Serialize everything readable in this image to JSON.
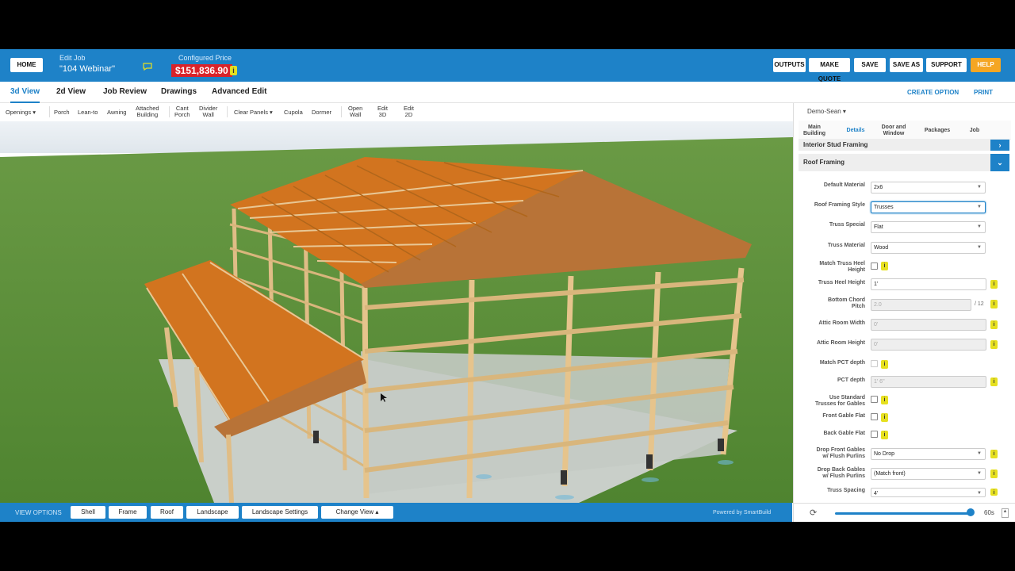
{
  "header": {
    "home_label": "HOME",
    "job_label": "Edit Job",
    "job_name": "\"104 Webinar\"",
    "price_label": "Configured Price",
    "price_value": "$151,836.90",
    "price_info": "i",
    "buttons": {
      "outputs": "OUTPUTS",
      "make_quote": "MAKE QUOTE",
      "save": "SAVE",
      "save_as": "SAVE AS",
      "support": "SUPPORT",
      "help": "HELP"
    }
  },
  "tabs": [
    "3d View",
    "2d View",
    "Job Review",
    "Drawings",
    "Advanced Edit"
  ],
  "tab_actions": {
    "create_option": "CREATE OPTION",
    "print": "PRINT"
  },
  "toolbar": {
    "openings": "Openings",
    "porch": "Porch",
    "lean_to": "Lean-to",
    "awning": "Awning",
    "attached_building": "Attached\nBuilding",
    "cant_porch": "Cant\nPorch",
    "divider_wall": "Divider\nWall",
    "clear_panels": "Clear Panels",
    "cupola": "Cupola",
    "dormer": "Dormer",
    "open_wall": "Open\nWall",
    "edit_3d": "Edit\n3D",
    "edit_2d": "Edit\n2D"
  },
  "bottom_bar": {
    "view_options": "VIEW OPTIONS",
    "shell": "Shell",
    "frame": "Frame",
    "roof": "Roof",
    "landscape": "Landscape",
    "landscape_settings": "Landscape Settings",
    "change_view": "Change View",
    "powered_by": "Powered by SmartBuild"
  },
  "panel": {
    "user": "Demo-Sean",
    "tabs": {
      "main_building": "Main\nBuilding",
      "details": "Details",
      "door_window": "Door and\nWindow",
      "packages": "Packages",
      "job": "Job"
    },
    "sections": {
      "interior_stud": "Interior Stud Framing",
      "roof_framing": "Roof Framing"
    },
    "fields": {
      "default_material": {
        "label": "Default Material",
        "value": "2x6"
      },
      "roof_framing_style": {
        "label": "Roof Framing Style",
        "value": "Trusses"
      },
      "truss_special": {
        "label": "Truss Special",
        "value": "Flat"
      },
      "truss_material": {
        "label": "Truss Material",
        "value": "Wood"
      },
      "match_truss_heel": {
        "label": "Match Truss Heel\nHeight"
      },
      "truss_heel_height": {
        "label": "Truss Heel Height",
        "value": "1'"
      },
      "bottom_chord_pitch": {
        "label": "Bottom Chord\nPitch",
        "value": "2.0",
        "suffix": "/ 12"
      },
      "attic_room_width": {
        "label": "Attic Room Width",
        "value": "0'"
      },
      "attic_room_height": {
        "label": "Attic Room Height",
        "value": "0'"
      },
      "match_pct_depth": {
        "label": "Match PCT depth"
      },
      "pct_depth": {
        "label": "PCT depth",
        "value": "1' 6\""
      },
      "use_standard_trusses": {
        "label": "Use Standard\nTrusses for Gables"
      },
      "front_gable_flat": {
        "label": "Front Gable Flat"
      },
      "back_gable_flat": {
        "label": "Back Gable Flat"
      },
      "drop_front_gables": {
        "label": "Drop Front Gables\nw/ Flush Purlins",
        "value": "No Drop"
      },
      "drop_back_gables": {
        "label": "Drop Back Gables\nw/ Flush Purlins",
        "value": "(Match front)"
      },
      "truss_spacing": {
        "label": "Truss Spacing",
        "value": "4'"
      }
    },
    "footer": {
      "refresh": "⟳",
      "seconds": "60s",
      "slider_value": 0.97
    }
  },
  "colors": {
    "brand_blue": "#1e82c8",
    "price_red": "#d9232a",
    "help_orange": "#f5a623",
    "roof_orange": "#c8742c",
    "wood": "#e4c08a",
    "grass": "#5d8f3a"
  }
}
